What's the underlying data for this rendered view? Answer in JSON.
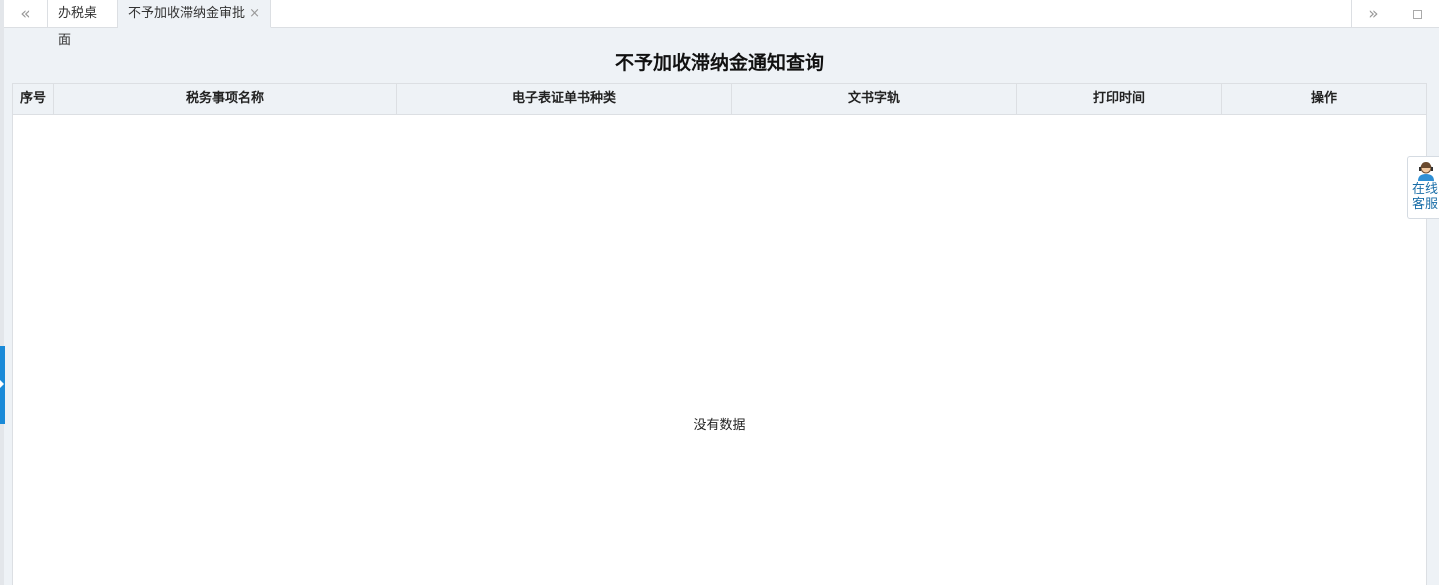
{
  "tabbar": {
    "tabs": [
      {
        "label": "办税桌面"
      },
      {
        "label": "不予加收滞纳金审批"
      }
    ],
    "prev_icon": "«",
    "next_icon": "»",
    "close_icon": "×"
  },
  "page": {
    "title": "不予加收滞纳金通知查询"
  },
  "table": {
    "columns": [
      "序号",
      "税务事项名称",
      "电子表证单书种类",
      "文书字轨",
      "打印时间",
      "操作"
    ],
    "empty_text": "没有数据"
  },
  "service": {
    "line1": "在线",
    "line2": "客服",
    "icon": "customer-service-icon"
  }
}
